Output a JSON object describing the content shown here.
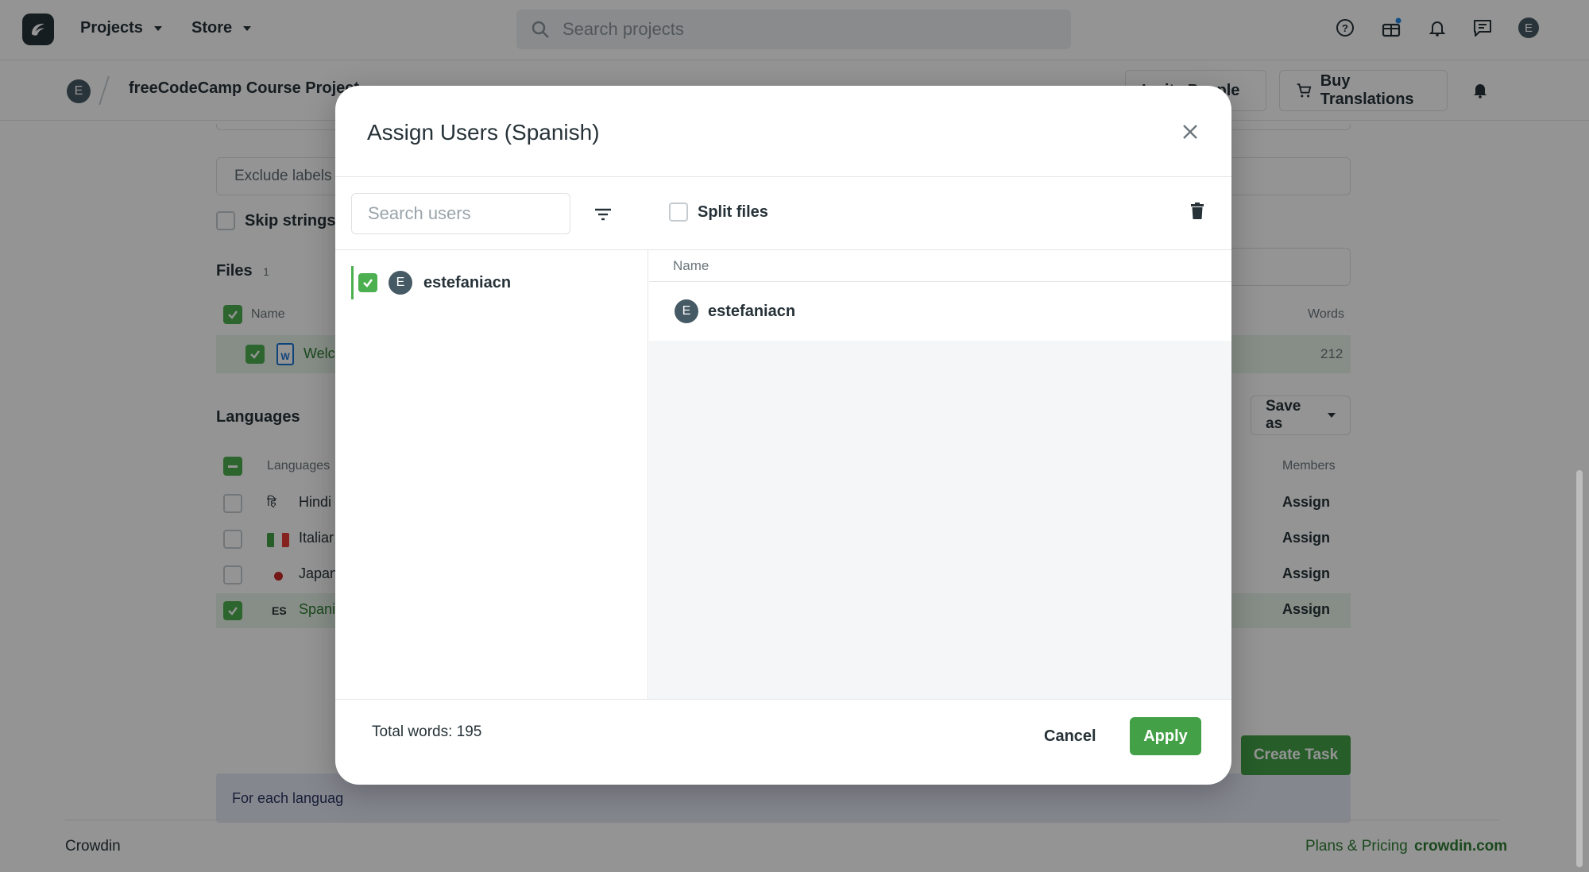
{
  "topbar": {
    "nav": [
      "Projects",
      "Store"
    ],
    "search_placeholder": "Search projects",
    "avatar_initial": "E"
  },
  "subbar": {
    "avatar_initial": "E",
    "project_title": "freeCodeCamp Course Project",
    "invite_label": "Invite People",
    "buy_label": "Buy Translations"
  },
  "background": {
    "exclude_labels": "Exclude labels",
    "skip_strings": "Skip strings al",
    "files_heading": "Files",
    "files_count": "1",
    "files_col_name": "Name",
    "files_col_words": "Words",
    "file_name": "Welc",
    "file_words": "212",
    "languages_heading": "Languages",
    "save_as": "Save as",
    "lang_col": "Languages",
    "members_col": "Members",
    "languages": [
      {
        "flag": "हि",
        "name": "Hindi",
        "assign": "Assign",
        "selected": false
      },
      {
        "flag": "",
        "name": "Italiar",
        "assign": "Assign",
        "selected": false
      },
      {
        "flag": "",
        "name": "Japan",
        "assign": "Assign",
        "selected": false
      },
      {
        "flag": "ES",
        "name": "Spani",
        "assign": "Assign",
        "selected": true
      }
    ],
    "info_text": "For each languag",
    "create_task": "Create Task"
  },
  "footer": {
    "brand": "Crowdin",
    "plans": "Plans & Pricing",
    "site": "crowdin.com"
  },
  "modal": {
    "title": "Assign Users (Spanish)",
    "search_placeholder": "Search users",
    "split_files": "Split files",
    "users": [
      {
        "initial": "E",
        "name": "estefaniacn",
        "checked": true
      }
    ],
    "table_header": "Name",
    "assigned": [
      {
        "initial": "E",
        "name": "estefaniacn"
      }
    ],
    "total_words": "Total words: 195",
    "cancel": "Cancel",
    "apply": "Apply"
  },
  "colors": {
    "accent": "#43a047",
    "checkbox": "#4caf50",
    "avatar": "#455a64",
    "overlay": "rgba(0,0,0,0.42)"
  }
}
